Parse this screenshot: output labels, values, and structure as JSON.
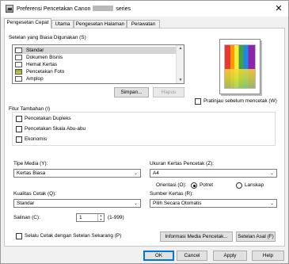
{
  "window": {
    "title_prefix": "Preferensi Pencetakan Canon",
    "title_suffix": "series",
    "close_glyph": "✕"
  },
  "tabs": [
    {
      "label": "Pengesetan Cepat",
      "active": true
    },
    {
      "label": "Utama"
    },
    {
      "label": "Pengesetan Halaman"
    },
    {
      "label": "Perawatan"
    }
  ],
  "quick": {
    "settings_label": "Setelan yang Biasa Digunakan (S)",
    "items": [
      {
        "label": "Standar",
        "icon": "standard-icon",
        "selected": true
      },
      {
        "label": "Dokumen Bisnis",
        "icon": "business-document-icon"
      },
      {
        "label": "Hemat Kertas",
        "icon": "paper-saving-icon"
      },
      {
        "label": "Pencetakan Foto",
        "icon": "photo-print-icon"
      },
      {
        "label": "Amplop",
        "icon": "envelope-icon"
      }
    ],
    "save_button": "Simpan...",
    "delete_button": "Hapus",
    "preview_label": "Pratinjau sebelum mencetak (W)",
    "extra_label": "Fitur Tambahan (I)",
    "extras": [
      {
        "label": "Pencetakan Dupleks",
        "checked": false
      },
      {
        "label": "Pencetakan Skala Abu-abu",
        "checked": false
      },
      {
        "label": "Ekonomis",
        "checked": false
      }
    ],
    "media_type_label": "Tipe Media (Y):",
    "media_type_value": "Kertas Biasa",
    "paper_size_label": "Ukuran Kertas Pencetak (Z):",
    "paper_size_value": "A4",
    "orientation_label": "Orientasi (O):",
    "orientation_portrait": "Potret",
    "orientation_landscape": "Lanskap",
    "orientation_selected": "Potret",
    "quality_label": "Kualitas Cetak (Q):",
    "quality_value": "Standar",
    "paper_source_label": "Sumber Kertas (R):",
    "paper_source_value": "Pilih Secara Otomatis",
    "copies_label": "Salinan (C):",
    "copies_value": "1",
    "copies_range": "(1-999)",
    "always_print_label": "Selalu Cetak dengan Setelan Sekarang (P)",
    "media_info_button": "Informasi Media Pencetak...",
    "defaults_button": "Setelan Asal (F)"
  },
  "footer": {
    "ok": "OK",
    "cancel": "Cancel",
    "apply": "Apply",
    "help": "Help"
  }
}
